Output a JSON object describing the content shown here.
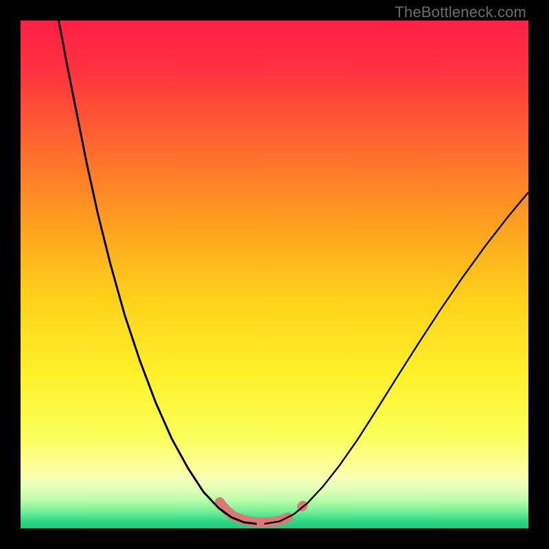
{
  "watermark": "TheBottleneck.com",
  "chart_data": {
    "type": "line",
    "title": "",
    "xlabel": "",
    "ylabel": "",
    "xlim": [
      0,
      1
    ],
    "ylim": [
      0,
      1
    ],
    "grid": false,
    "legend": null,
    "gradient_stops": [
      {
        "offset": 0.0,
        "color": "#ff1f47"
      },
      {
        "offset": 0.1,
        "color": "#ff333e"
      },
      {
        "offset": 0.25,
        "color": "#ff6a2e"
      },
      {
        "offset": 0.4,
        "color": "#ff9f1f"
      },
      {
        "offset": 0.55,
        "color": "#ffd21a"
      },
      {
        "offset": 0.7,
        "color": "#fff12a"
      },
      {
        "offset": 0.82,
        "color": "#fbff5a"
      },
      {
        "offset": 0.885,
        "color": "#fdffa0"
      },
      {
        "offset": 0.905,
        "color": "#f3ffb8"
      },
      {
        "offset": 0.925,
        "color": "#deffb5"
      },
      {
        "offset": 0.945,
        "color": "#b9fda8"
      },
      {
        "offset": 0.965,
        "color": "#7af09a"
      },
      {
        "offset": 0.985,
        "color": "#31d884"
      },
      {
        "offset": 1.0,
        "color": "#1fca7a"
      }
    ],
    "series": [
      {
        "name": "left-arm",
        "stroke": "#000000",
        "stroke_width": 3,
        "points": [
          {
            "x": 0.075,
            "y": 1.0
          },
          {
            "x": 0.092,
            "y": 0.91
          },
          {
            "x": 0.11,
            "y": 0.82
          },
          {
            "x": 0.13,
            "y": 0.72
          },
          {
            "x": 0.152,
            "y": 0.62
          },
          {
            "x": 0.177,
            "y": 0.52
          },
          {
            "x": 0.205,
            "y": 0.42
          },
          {
            "x": 0.235,
            "y": 0.33
          },
          {
            "x": 0.266,
            "y": 0.248
          },
          {
            "x": 0.298,
            "y": 0.176
          },
          {
            "x": 0.33,
            "y": 0.118
          },
          {
            "x": 0.36,
            "y": 0.072
          },
          {
            "x": 0.39,
            "y": 0.04
          },
          {
            "x": 0.415,
            "y": 0.022
          },
          {
            "x": 0.44,
            "y": 0.012
          },
          {
            "x": 0.465,
            "y": 0.009
          }
        ]
      },
      {
        "name": "right-arm",
        "stroke": "#000000",
        "stroke_width": 2.4,
        "points": [
          {
            "x": 0.48,
            "y": 0.009
          },
          {
            "x": 0.51,
            "y": 0.014
          },
          {
            "x": 0.538,
            "y": 0.028
          },
          {
            "x": 0.565,
            "y": 0.05
          },
          {
            "x": 0.595,
            "y": 0.082
          },
          {
            "x": 0.628,
            "y": 0.124
          },
          {
            "x": 0.663,
            "y": 0.174
          },
          {
            "x": 0.7,
            "y": 0.232
          },
          {
            "x": 0.74,
            "y": 0.296
          },
          {
            "x": 0.782,
            "y": 0.362
          },
          {
            "x": 0.825,
            "y": 0.428
          },
          {
            "x": 0.87,
            "y": 0.494
          },
          {
            "x": 0.915,
            "y": 0.556
          },
          {
            "x": 0.96,
            "y": 0.614
          },
          {
            "x": 1.0,
            "y": 0.662
          }
        ]
      },
      {
        "name": "bottom-marker-band",
        "stroke": "#d87b77",
        "stroke_width": 14,
        "linecap": "round",
        "points": [
          {
            "x": 0.392,
            "y": 0.052
          },
          {
            "x": 0.405,
            "y": 0.036
          },
          {
            "x": 0.42,
            "y": 0.024
          },
          {
            "x": 0.438,
            "y": 0.017
          },
          {
            "x": 0.458,
            "y": 0.013
          },
          {
            "x": 0.478,
            "y": 0.012
          },
          {
            "x": 0.497,
            "y": 0.013
          },
          {
            "x": 0.513,
            "y": 0.016
          },
          {
            "x": 0.527,
            "y": 0.022
          }
        ]
      },
      {
        "name": "bottom-marker-dot",
        "stroke": "#d87b77",
        "stroke_width": 14,
        "linecap": "round",
        "points": [
          {
            "x": 0.554,
            "y": 0.043
          },
          {
            "x": 0.556,
            "y": 0.045
          }
        ]
      }
    ]
  }
}
